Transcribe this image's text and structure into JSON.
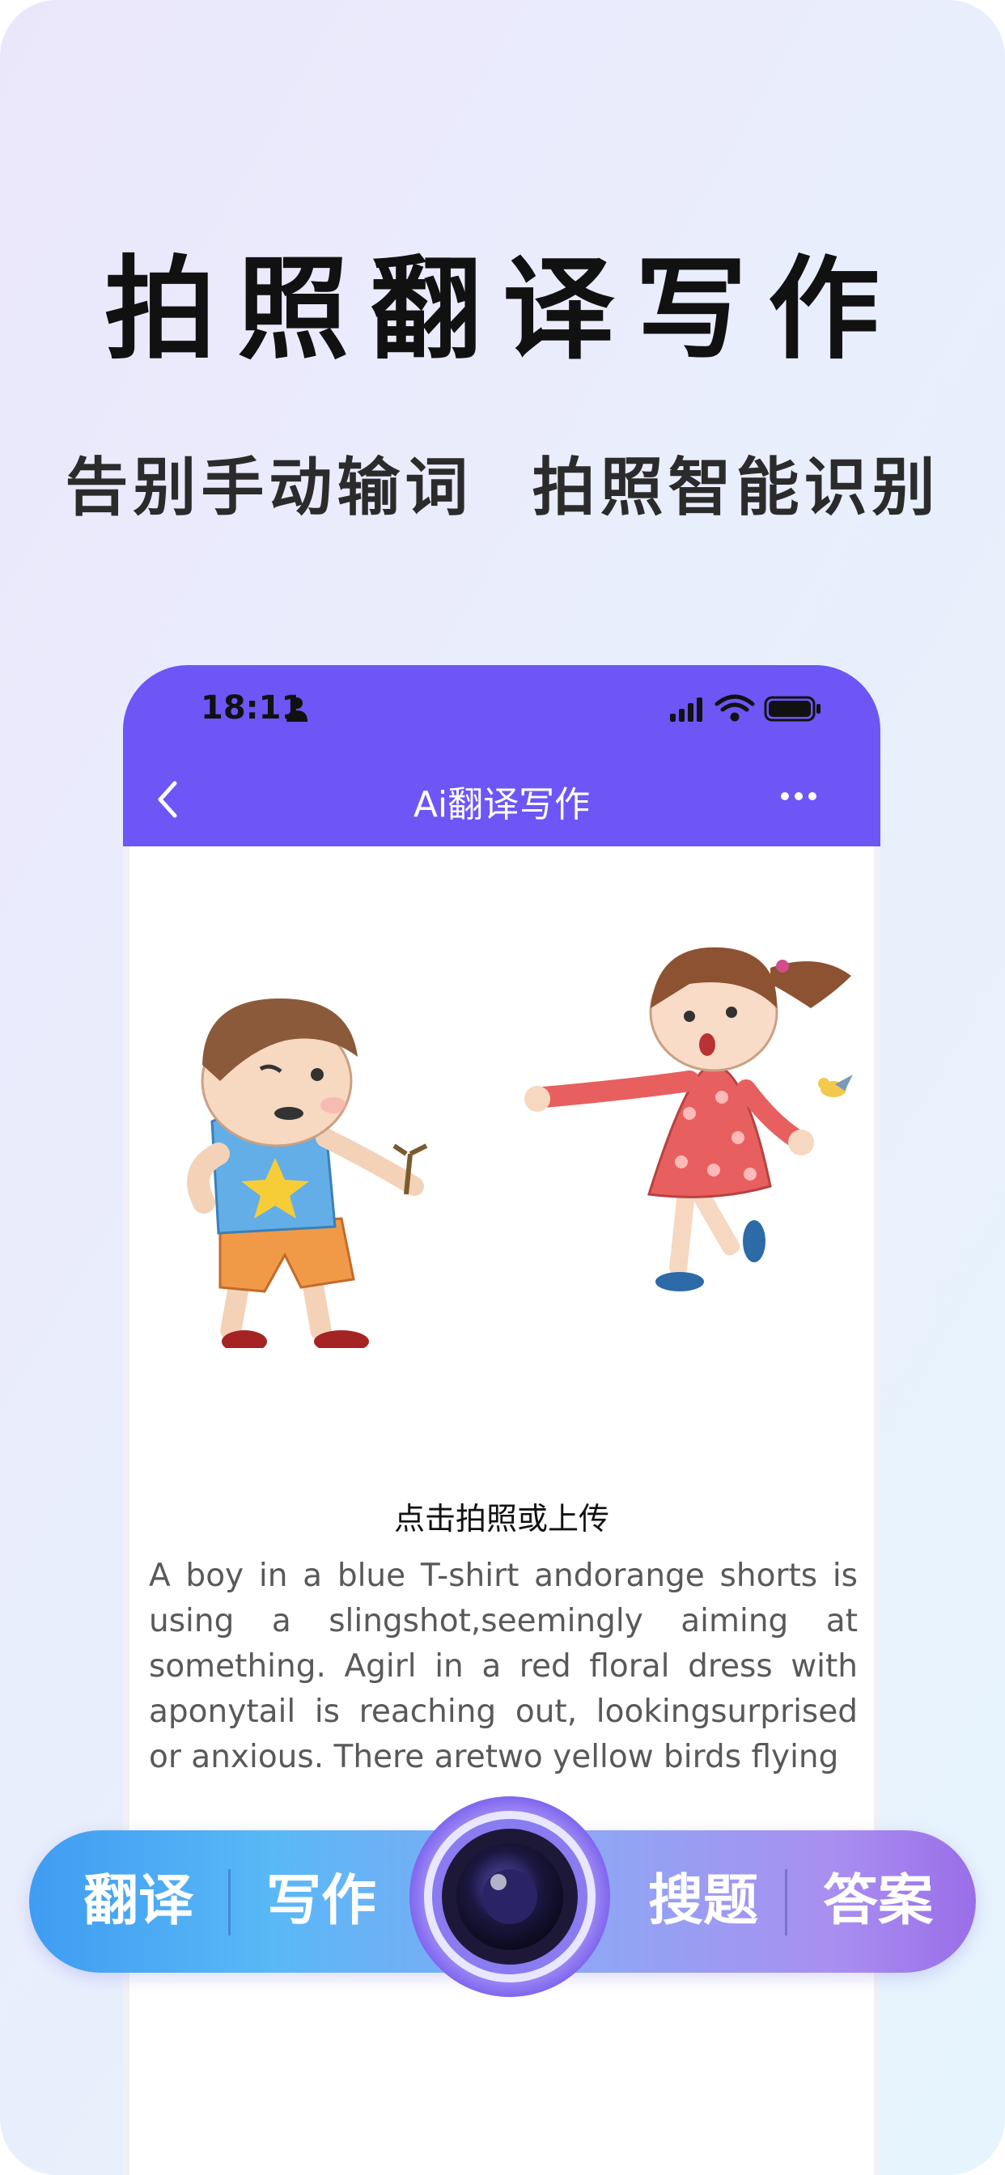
{
  "headline": "拍照翻译写作",
  "subheadline": "告别手动输词 拍照智能识别",
  "status_bar": {
    "time": "18:11",
    "person_icon": "person-icon",
    "signal_icon": "signal-icon",
    "wifi_icon": "wifi-icon",
    "battery_icon": "battery-icon"
  },
  "nav": {
    "back_icon": "chevron-left-icon",
    "title": "Ai翻译写作",
    "more_icon": "more-horizontal-icon"
  },
  "illustration": "children-illustration",
  "action_text": "点击拍照或上传",
  "description": "A boy in a blue T-shirt andorange shorts is using a slingshot,seemingly aiming at something. Agirl in a red floral dress with aponytail is reaching out, lookingsurprised or anxious. There aretwo yellow birds flying",
  "bottom_bar": {
    "translate": "翻译",
    "write": "写作",
    "camera_icon": "camera-lens-icon",
    "search": "搜题",
    "answer": "答案"
  },
  "colors": {
    "accent": "#6d56f5",
    "pill_start": "#3f9cf2",
    "pill_end": "#9a6ee8"
  }
}
